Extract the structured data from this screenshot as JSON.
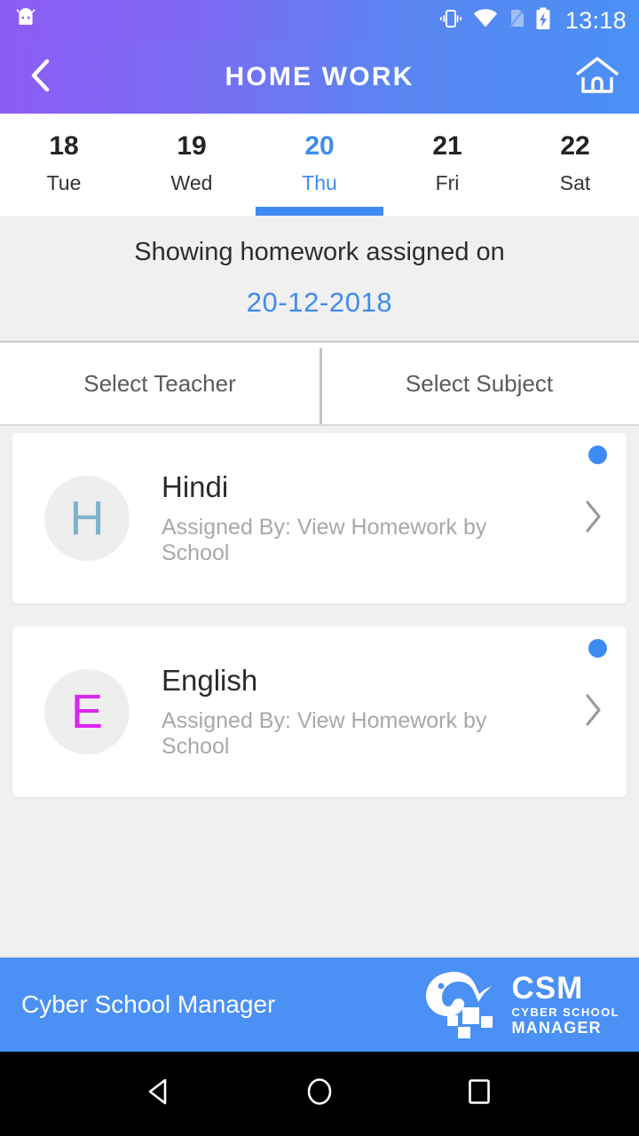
{
  "status_bar": {
    "time": "13:18",
    "icons": [
      "app-notification-icon",
      "vibrate-icon",
      "wifi-icon",
      "no-sim-icon",
      "battery-charging-icon"
    ]
  },
  "app_bar": {
    "title": "HOME WORK",
    "back_icon": "chevron-left-icon",
    "home_icon": "home-icon",
    "gradient_from": "#8d5cf6",
    "gradient_to": "#4a90f5"
  },
  "date_strip": {
    "days": [
      {
        "num": "18",
        "day": "Tue",
        "selected": false
      },
      {
        "num": "19",
        "day": "Wed",
        "selected": false
      },
      {
        "num": "20",
        "day": "Thu",
        "selected": true
      },
      {
        "num": "21",
        "day": "Fri",
        "selected": false
      },
      {
        "num": "22",
        "day": "Sat",
        "selected": false
      }
    ],
    "accent_color": "#3d8bf2"
  },
  "banner": {
    "line1": "Showing homework assigned on",
    "date": "20-12-2018"
  },
  "filters": {
    "teacher_label": "Select Teacher",
    "subject_label": "Select Subject"
  },
  "homework": {
    "items": [
      {
        "initial": "H",
        "initial_color": "#7fb3cc",
        "subject": "Hindi",
        "assigned_by": "Assigned By: View Homework by School",
        "unread": true,
        "chevron_icon": "chevron-right-icon"
      },
      {
        "initial": "E",
        "initial_color": "#d926f2",
        "subject": "English",
        "assigned_by": "Assigned By: View Homework by School",
        "unread": true,
        "chevron_icon": "chevron-right-icon"
      }
    ],
    "unread_dot_color": "#3d8bf2"
  },
  "footer": {
    "brand_text": "Cyber School Manager",
    "logo_abbr": "CSM",
    "logo_line2": "CYBER SCHOOL",
    "logo_line3": "MANAGER",
    "background": "#4a90f5"
  },
  "nav_bar": {
    "back_icon": "triangle-back-icon",
    "home_icon": "circle-home-icon",
    "recents_icon": "square-recents-icon"
  }
}
